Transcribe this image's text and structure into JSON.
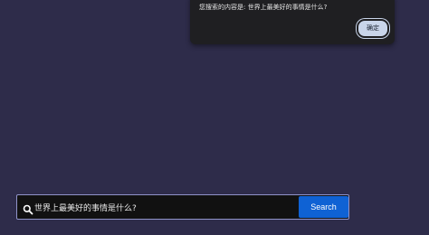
{
  "dialog": {
    "message": "您搜索的内容是: 世界上最美好的事情是什么?",
    "ok_label": "确定"
  },
  "search": {
    "value": "世界上最美好的事情是什么?",
    "button_label": "Search",
    "icon": "search-icon"
  },
  "colors": {
    "background": "#2e2c4a",
    "dialog_bg": "#1f1f22",
    "ok_button": "#c9d5ea",
    "search_bar_bg": "#111111",
    "search_border": "#9093c9",
    "search_button": "#0f62d4"
  }
}
